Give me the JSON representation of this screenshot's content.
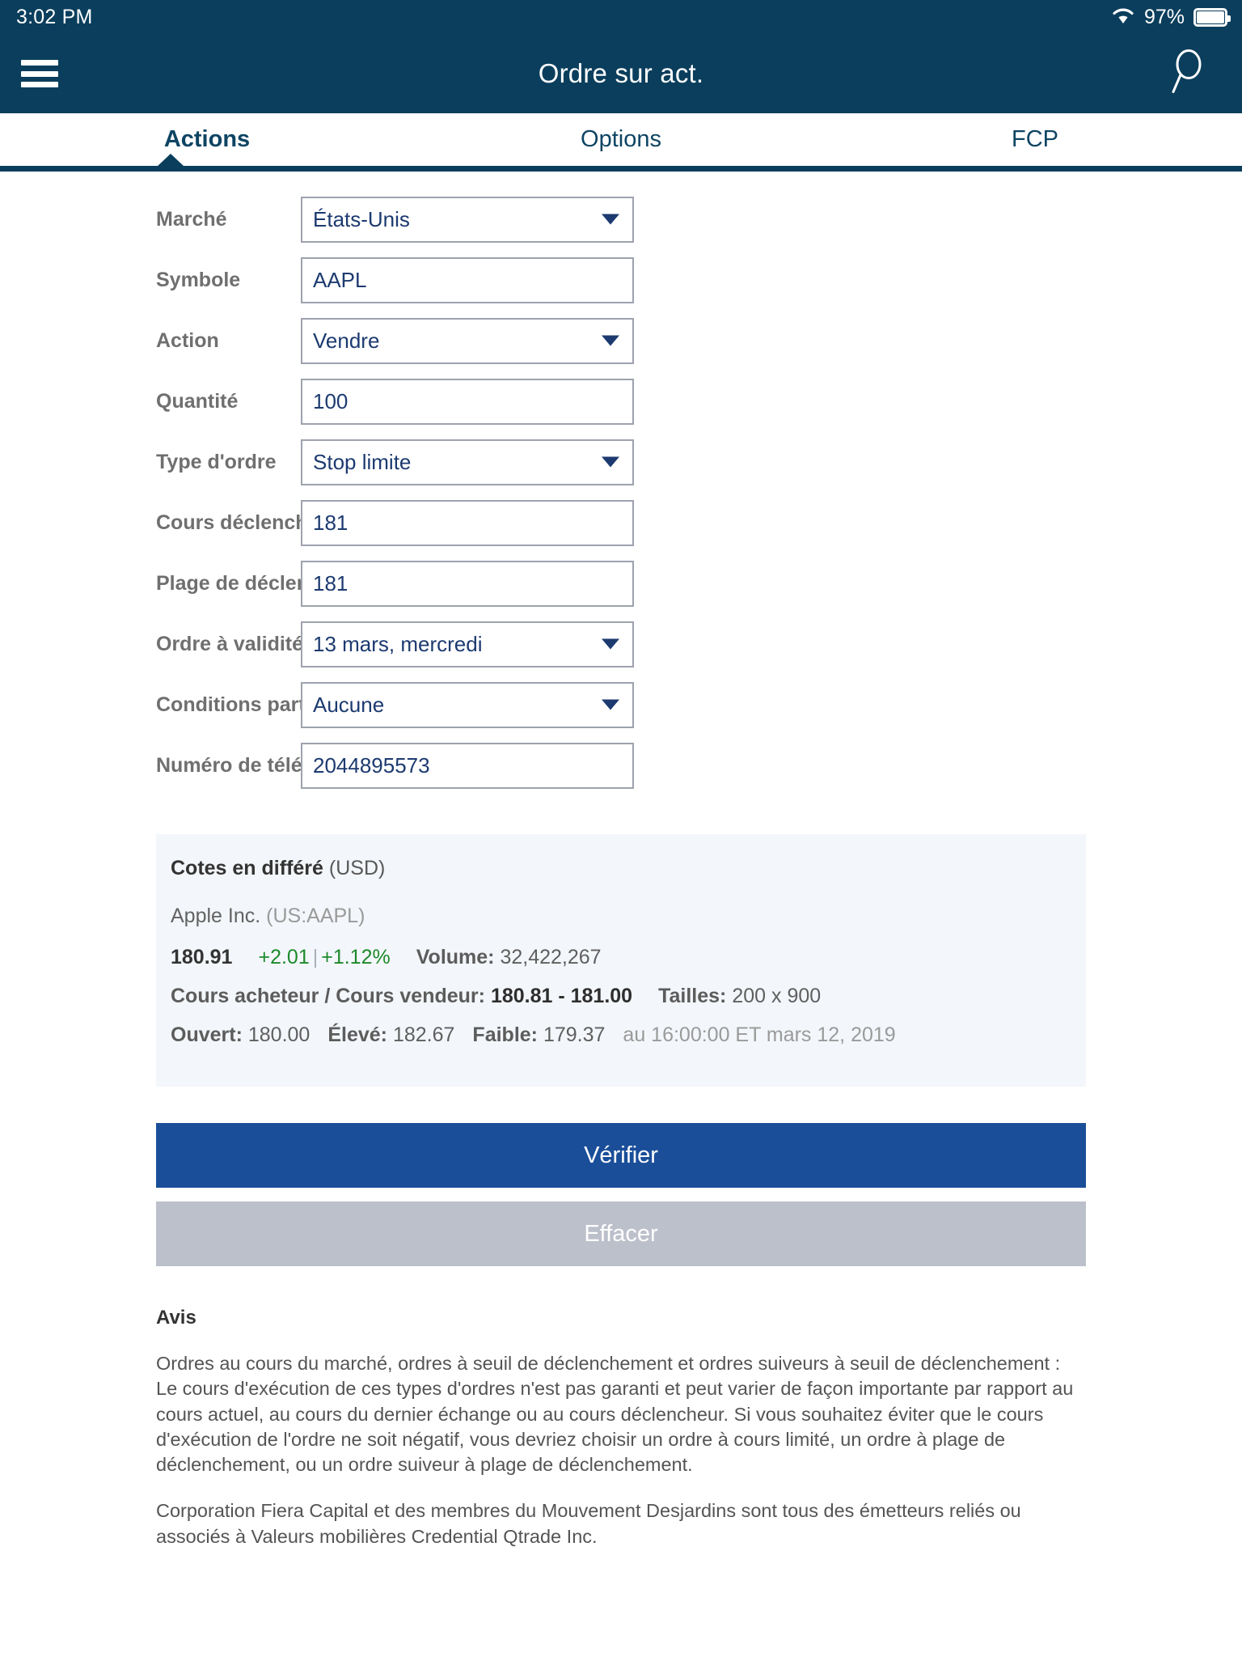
{
  "status_bar": {
    "time": "3:02 PM",
    "battery_pct": "97%",
    "wifi_icon": "wifi-icon",
    "battery_icon": "battery-icon"
  },
  "nav": {
    "menu_icon": "hamburger-menu-icon",
    "title": "Ordre sur act.",
    "search_icon": "search-icon"
  },
  "tabs": [
    {
      "label": "Actions",
      "active": true
    },
    {
      "label": "Options",
      "active": false
    },
    {
      "label": "FCP",
      "active": false
    }
  ],
  "form": {
    "fields": [
      {
        "label": "Marché",
        "value": "États-Unis",
        "type": "select"
      },
      {
        "label": "Symbole",
        "value": "AAPL",
        "type": "text"
      },
      {
        "label": "Action",
        "value": "Vendre",
        "type": "select"
      },
      {
        "label": "Quantité",
        "value": "100",
        "type": "text"
      },
      {
        "label": "Type d'ordre",
        "value": "Stop limite",
        "type": "select"
      },
      {
        "label": "Cours déclencheur",
        "value": "181",
        "type": "text"
      },
      {
        "label": "Plage de déclenchement",
        "value": "181",
        "type": "text"
      },
      {
        "label": "Ordre à validité limitée",
        "value": "13 mars, mercredi",
        "type": "select"
      },
      {
        "label": "Conditions particulières",
        "value": "Aucune",
        "type": "select"
      },
      {
        "label": "Numéro de téléphone",
        "value": "2044895573",
        "type": "text"
      }
    ]
  },
  "quote": {
    "heading_bold": "Cotes en différé",
    "heading_currency": "(USD)",
    "company_name": "Apple Inc.",
    "ticker": "(US:AAPL)",
    "last_price": "180.91",
    "change": "+2.01",
    "change_separator": "|",
    "change_pct": "+1.12%",
    "volume_label": "Volume:",
    "volume_value": "32,422,267",
    "bid_ask_label": "Cours acheteur / Cours vendeur:",
    "bid_ask_value": "180.81 - 181.00",
    "sizes_label": "Tailles:",
    "sizes_value": "200 x 900",
    "open_label": "Ouvert:",
    "open_value": "180.00",
    "high_label": "Élevé:",
    "high_value": "182.67",
    "low_label": "Faible:",
    "low_value": "179.37",
    "as_of": "au 16:00:00 ET mars 12, 2019"
  },
  "buttons": {
    "verify": "Vérifier",
    "clear": "Effacer"
  },
  "notice": {
    "title": "Avis",
    "paragraph_1": "Ordres au cours du marché, ordres à seuil de déclenchement et ordres suiveurs à seuil de déclenchement : Le cours d'exécution de ces types d'ordres n'est pas garanti et peut varier de façon importante par rapport au cours actuel, au cours du dernier échange ou au cours déclencheur. Si vous souhaitez éviter que le cours d'exécution de l'ordre ne soit négatif, vous devriez choisir un ordre à cours limité, un ordre à plage de déclenchement, ou un ordre suiveur à plage de déclenchement.",
    "paragraph_2": "Corporation Fiera Capital et des membres du Mouvement Desjardins sont tous des émetteurs reliés ou associés à Valeurs mobilières Credential Qtrade Inc."
  },
  "colors": {
    "header_navy": "#0a3e5c",
    "primary_button": "#1a4e99",
    "secondary_button": "#bcc0cb",
    "value_text": "#1c3a70",
    "label_text": "#6f6f6f",
    "positive_green": "#1d8a2b",
    "quote_bg": "#f3f6fa"
  }
}
